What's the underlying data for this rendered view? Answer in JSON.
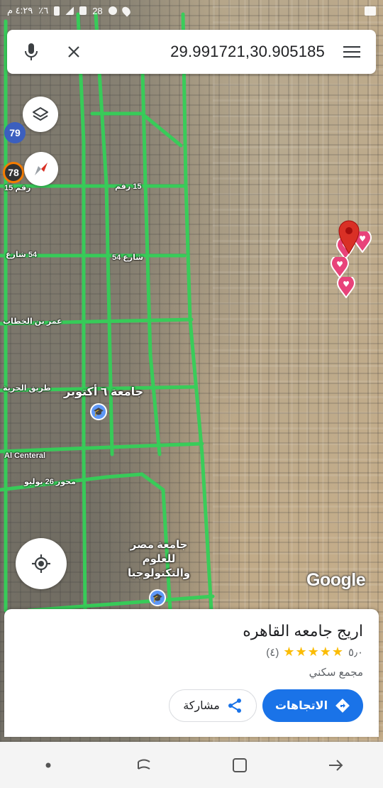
{
  "status_bar": {
    "time": "٤:٢٩ م",
    "battery": "٪٦",
    "signal": "28"
  },
  "search": {
    "query": "29.991721,30.905185",
    "icons": {
      "mic": "mic-icon",
      "clear": "close-icon",
      "menu": "menu-icon"
    }
  },
  "map": {
    "place_label": "جامعة ٦ أكتوبر",
    "university_label_line1": "جامعة مصر",
    "university_label_line2": "للعلوم",
    "university_label_line3": "والتكنولوجيا",
    "road_al_central": "Al Centeral",
    "road_axis_26": "محور 26 يوليو",
    "road_15": "رقم 15",
    "road_15b": "15 رقم",
    "road_54": "شارع 54",
    "road_54b": "54 شارع",
    "road_omar": "عمر بن الخطاب",
    "road_horreya": "طريق الحرية",
    "route_79": "79",
    "route_78": "78",
    "google_logo": "Google",
    "pin_color": "#d93025",
    "heart_pin_color": "#e8437a",
    "road_color": "#34d058"
  },
  "place": {
    "title": "اريج جامعه القاهره",
    "rating": "٥٫٠",
    "stars": "★★★★★",
    "review_count": "(٤)",
    "type": "مجمع سكني",
    "directions_label": "الاتجاهات",
    "share_label": "مشاركة",
    "accent": "#1a73e8"
  },
  "nav_bar": {
    "items": [
      "dot-icon",
      "recent-apps-icon",
      "home-icon",
      "back-icon"
    ]
  }
}
